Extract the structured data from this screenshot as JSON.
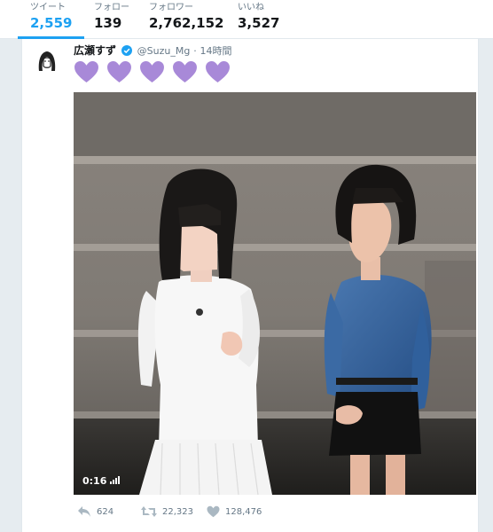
{
  "stats": [
    {
      "label": "ツイート",
      "value": "2,559"
    },
    {
      "label": "フォロー",
      "value": "139"
    },
    {
      "label": "フォロワー",
      "value": "2,762,152"
    },
    {
      "label": "いいね",
      "value": "3,527"
    }
  ],
  "tweet": {
    "name": "広瀬すず",
    "handle": "@Suzu_Mg",
    "separator": "·",
    "time": "14時間",
    "verified_icon": "verified-badge-icon",
    "content_icons": [
      "purple-heart-icon",
      "purple-heart-icon",
      "purple-heart-icon",
      "purple-heart-icon",
      "purple-heart-icon"
    ],
    "video": {
      "duration": "0:16"
    },
    "actions": {
      "reply": "624",
      "retweet": "22,323",
      "like": "128,476"
    }
  },
  "colors": {
    "accent": "#1da1f2",
    "heart": "#a889d8",
    "muted": "#657786"
  }
}
